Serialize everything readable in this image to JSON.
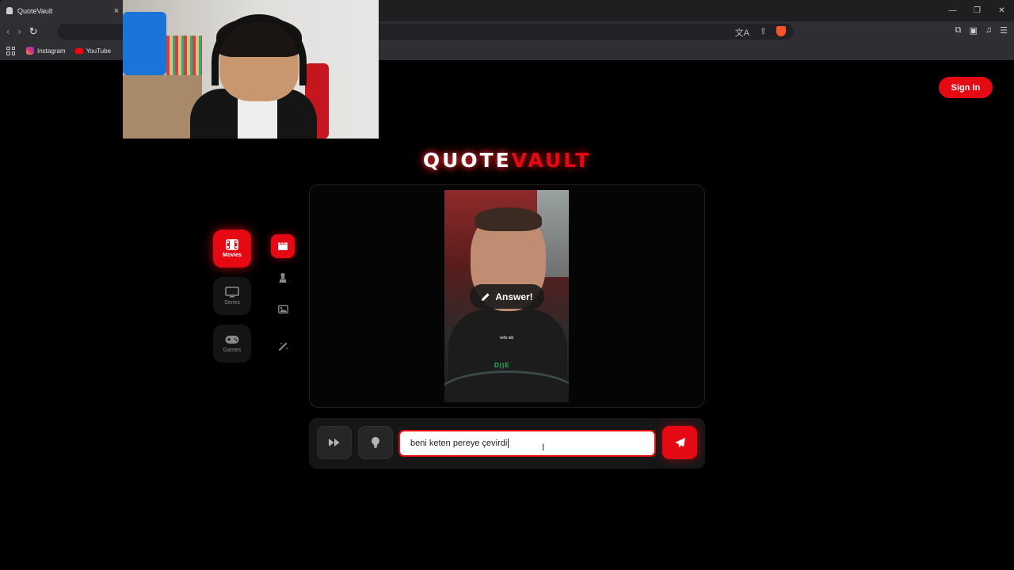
{
  "browser": {
    "tab_title": "QuoteVault",
    "tab_close": "×",
    "window_controls": {
      "minimize": "—",
      "restore": "❐",
      "close": "✕"
    },
    "nav": {
      "back": "‹",
      "forward": "›",
      "reload": "↻"
    },
    "bookmarks": [
      "Instagram",
      "YouTube"
    ]
  },
  "header": {
    "sign_in_label": "Sign In"
  },
  "logo": {
    "part1": "QUOTE",
    "part2": "VAULT"
  },
  "categories": [
    {
      "label": "Movies",
      "icon": "film-icon",
      "active": true
    },
    {
      "label": "Series",
      "icon": "monitor-icon",
      "active": false
    },
    {
      "label": "Games",
      "icon": "gamepad-icon",
      "active": false
    }
  ],
  "modes": [
    {
      "icon": "clapperboard-icon",
      "active": true
    },
    {
      "icon": "character-icon",
      "active": false
    },
    {
      "icon": "image-icon",
      "active": false
    },
    {
      "icon": "magic-wand-icon",
      "active": false
    }
  ],
  "media": {
    "answer_label": "Answer!",
    "caption": "vefa abi"
  },
  "input": {
    "value": "beni keten pereye çevirdi",
    "skip_icon": "fast-forward-icon",
    "hint_icon": "lightbulb-icon",
    "send_icon": "send-icon"
  },
  "colors": {
    "accent": "#e50914",
    "background": "#000000"
  }
}
